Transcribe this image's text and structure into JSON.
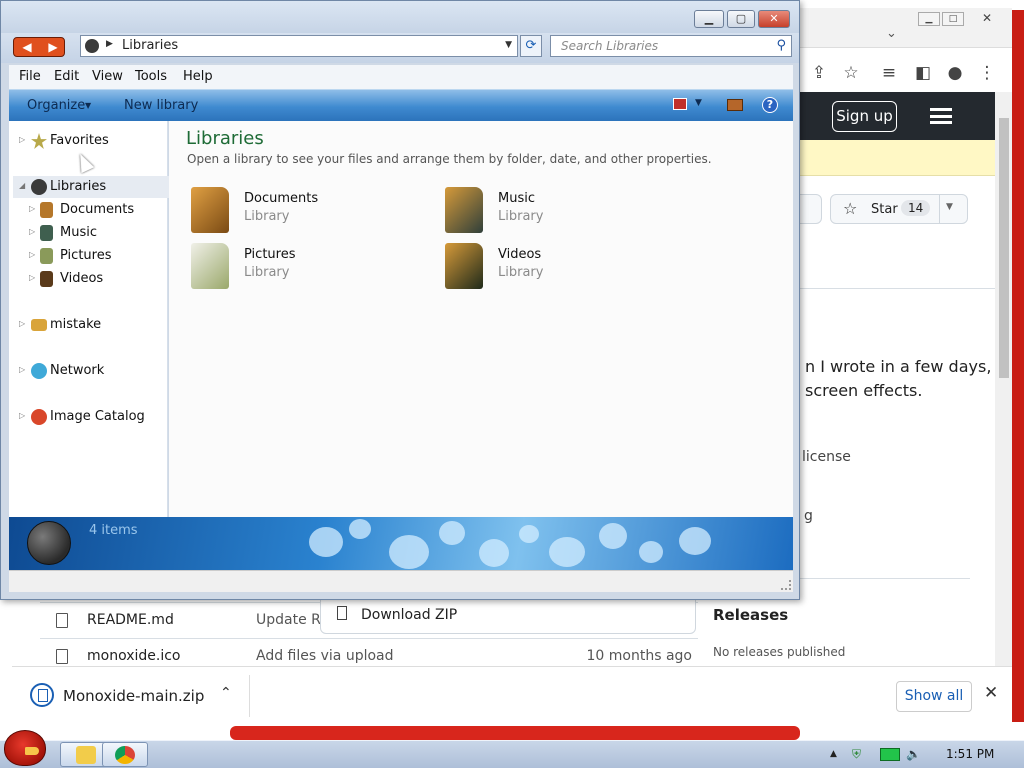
{
  "explorer": {
    "address_text": "Libraries",
    "search_placeholder": "Search Libraries",
    "menu": [
      "File",
      "Edit",
      "View",
      "Tools",
      "Help"
    ],
    "commands": [
      "Organize",
      "New library"
    ],
    "nav_items": [
      {
        "label": "Favorites",
        "icon": "star-icon"
      },
      {
        "label": "Libraries",
        "icon": "libraries-icon"
      },
      {
        "label": "Documents",
        "icon": "documents-icon"
      },
      {
        "label": "Music",
        "icon": "music-icon"
      },
      {
        "label": "Pictures",
        "icon": "pictures-icon"
      },
      {
        "label": "Videos",
        "icon": "videos-icon"
      },
      {
        "label": "mistake",
        "icon": "folder-icon"
      },
      {
        "label": "Network",
        "icon": "network-icon"
      },
      {
        "label": "Image Catalog",
        "icon": "image-catalog-icon"
      }
    ],
    "heading": "Libraries",
    "subheading": "Open a library to see your files and arrange them by folder, date, and other properties.",
    "libraries": [
      {
        "name": "Documents",
        "type": "Library"
      },
      {
        "name": "Music",
        "type": "Library"
      },
      {
        "name": "Pictures",
        "type": "Library"
      },
      {
        "name": "Videos",
        "type": "Library"
      }
    ],
    "item_count": "4 items"
  },
  "browser": {
    "signup": "Sign up",
    "star_label": "Star",
    "star_count": "14",
    "desc_line1": "n I wrote in a few days,",
    "desc_line2": "screen effects.",
    "license": "license",
    "partial": "g",
    "releases_title": "Releases",
    "releases_empty": "No releases published",
    "download_zip": "Download ZIP",
    "files": [
      {
        "name": "README.md",
        "message": "Update RE",
        "date": ""
      },
      {
        "name": "monoxide.ico",
        "message": "Add files via upload",
        "date": "10 months ago"
      }
    ],
    "download_file": "Monoxide-main.zip",
    "show_all": "Show all"
  },
  "taskbar": {
    "clock": "1:51 PM"
  },
  "colors": {
    "explorer_heading": "#1e6b36",
    "cmdbar_blue": "#3f8ad0",
    "github_nav": "#24292f",
    "desktop_red": "#c81d14"
  }
}
